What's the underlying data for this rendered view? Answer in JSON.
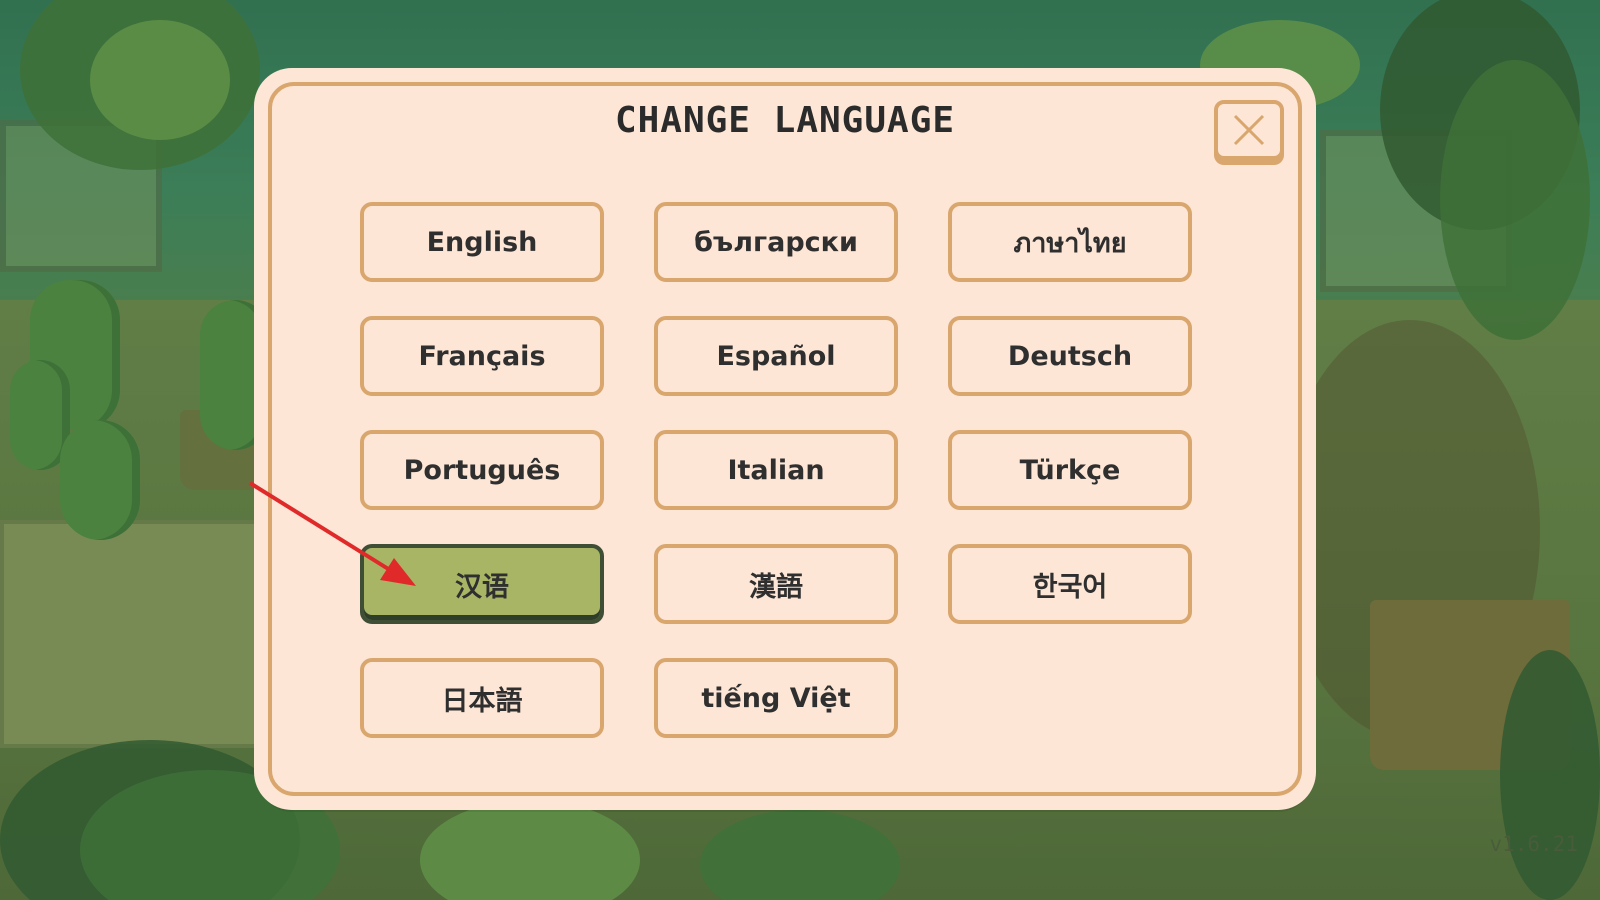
{
  "dialog": {
    "title": "CHANGE LANGUAGE",
    "close_icon": "close-icon"
  },
  "languages": [
    {
      "label": "English",
      "selected": false
    },
    {
      "label": "български",
      "selected": false
    },
    {
      "label": "ภาษาไทย",
      "selected": false
    },
    {
      "label": "Français",
      "selected": false
    },
    {
      "label": "Español",
      "selected": false
    },
    {
      "label": "Deutsch",
      "selected": false
    },
    {
      "label": "Português",
      "selected": false
    },
    {
      "label": "Italian",
      "selected": false
    },
    {
      "label": "Türkçe",
      "selected": false
    },
    {
      "label": "汉语",
      "selected": true
    },
    {
      "label": "漢語",
      "selected": false
    },
    {
      "label": "한국어",
      "selected": false
    },
    {
      "label": "日本語",
      "selected": false
    },
    {
      "label": "tiếng Việt",
      "selected": false
    }
  ],
  "footer": {
    "version": "v1.6.21"
  },
  "colors": {
    "panel": "#fde6d6",
    "border": "#d9a66e",
    "selected": "#a7b565",
    "annotation_arrow": "#e02a2a"
  }
}
